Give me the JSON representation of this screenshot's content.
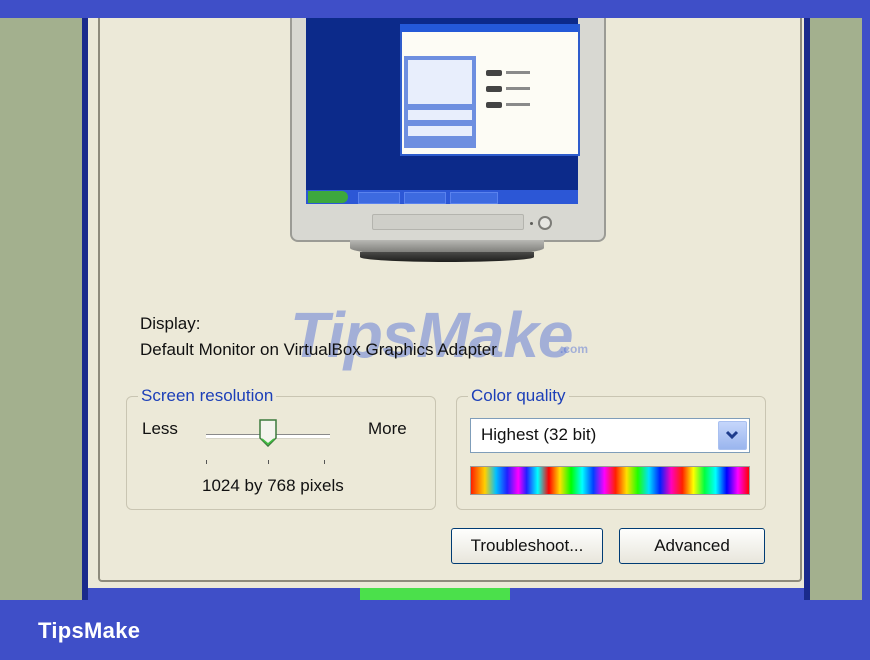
{
  "display": {
    "heading": "Display:",
    "device": "Default Monitor on VirtualBox Graphics Adapter"
  },
  "screen_resolution": {
    "title": "Screen resolution",
    "less_label": "Less",
    "more_label": "More",
    "value_text": "1024 by 768 pixels",
    "slider_level": 0.5
  },
  "color_quality": {
    "title": "Color quality",
    "selected": "Highest (32 bit)"
  },
  "buttons": {
    "troubleshoot": "Troubleshoot...",
    "advanced": "Advanced"
  },
  "branding": {
    "footer_text": "TipsMake",
    "watermark_main": "TipsMake",
    "watermark_suffix": ".com"
  },
  "colors": {
    "frame_blue": "#3f4fc8",
    "side_green": "#a3b08e",
    "dialog_bg": "#ece9d8",
    "group_title_blue": "#1c3fb8"
  }
}
